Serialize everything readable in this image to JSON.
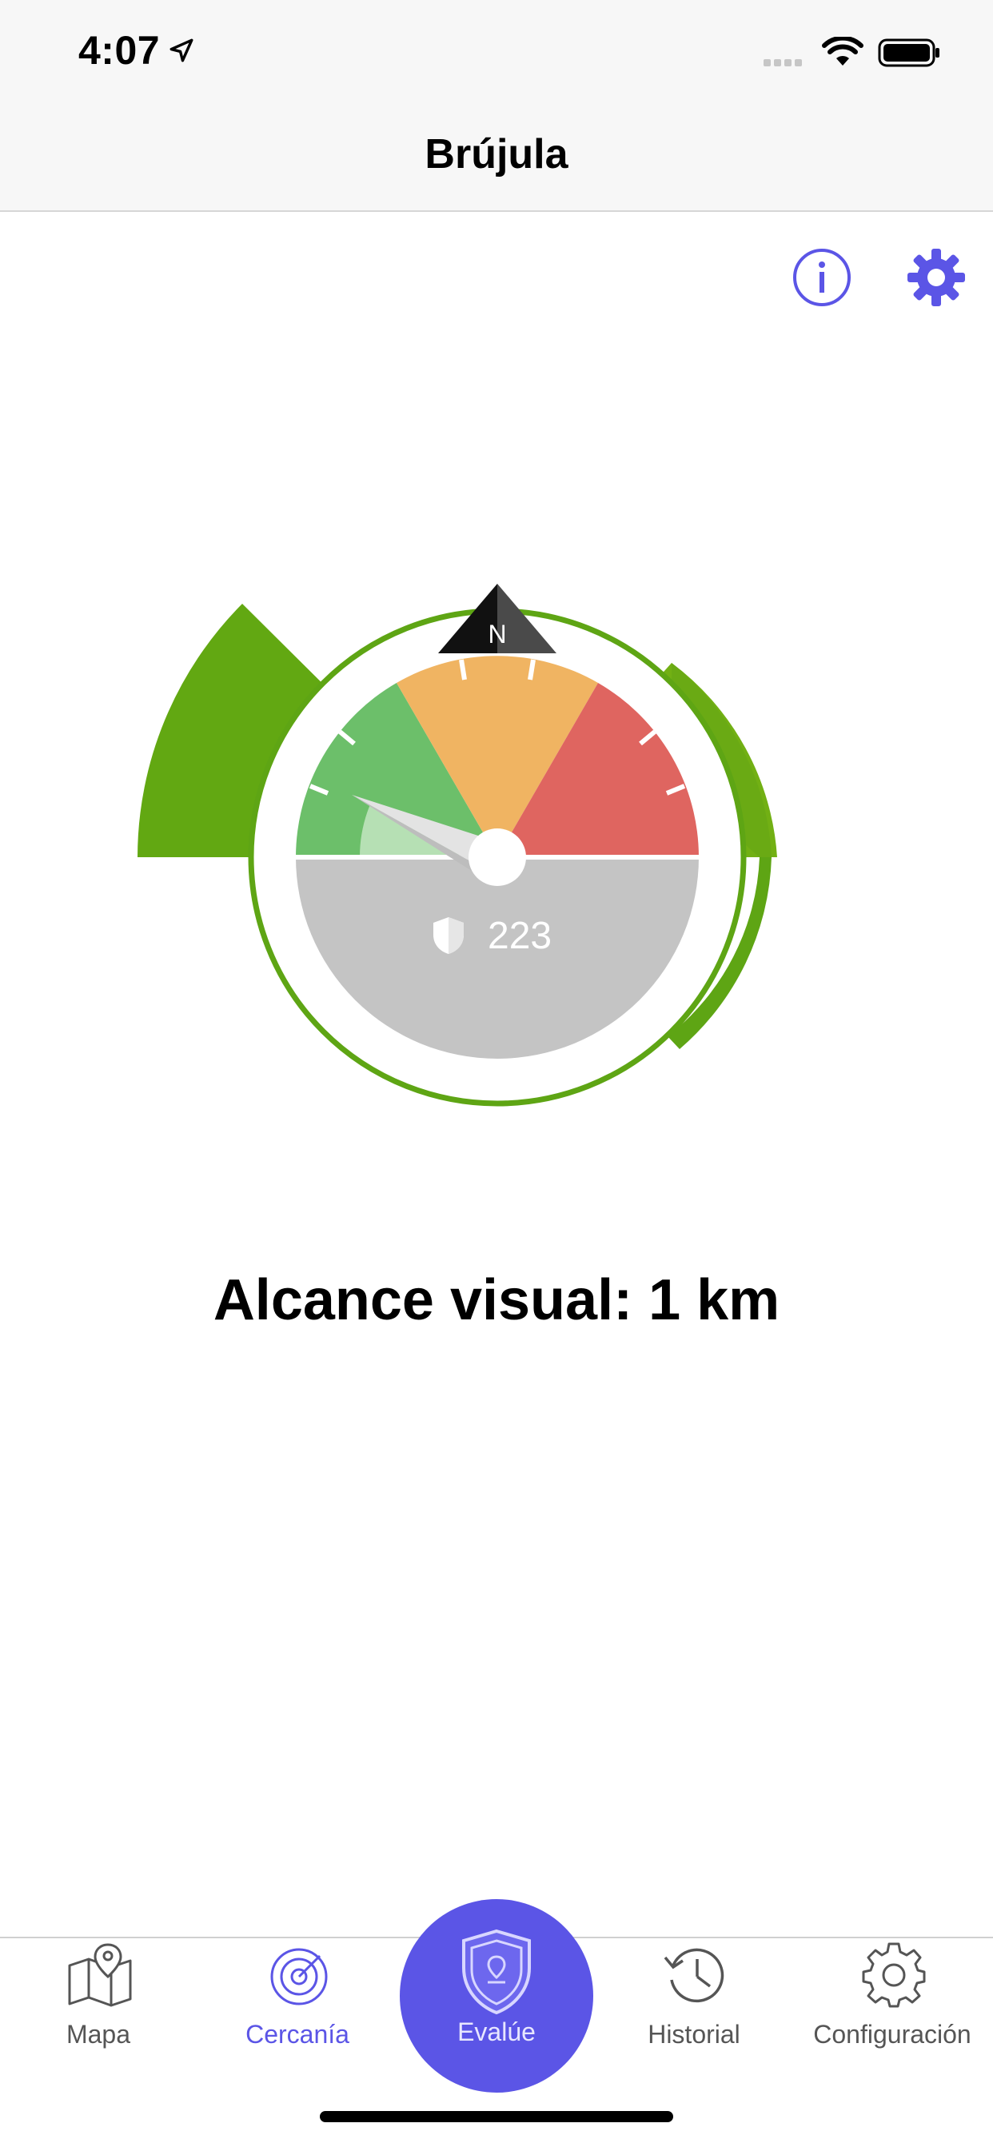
{
  "status": {
    "time": "4:07"
  },
  "nav": {
    "title": "Brújula"
  },
  "gauge": {
    "value": "223",
    "north_label": "N"
  },
  "reach": {
    "text": "Alcance visual: 1 km"
  },
  "tabs": [
    {
      "label": "Mapa",
      "icon": "map-icon"
    },
    {
      "label": "Cercanía",
      "icon": "radar-icon"
    },
    {
      "label": "Evalúe",
      "icon": "shield-location-icon"
    },
    {
      "label": "Historial",
      "icon": "history-icon"
    },
    {
      "label": "Configuración",
      "icon": "gear-icon"
    }
  ],
  "colors": {
    "accent": "#5b55e6",
    "green": "#6cbf6a",
    "orange": "#f0b462",
    "red": "#df6560",
    "gray": "#c4c4c4",
    "ring_green": "#5ea514"
  }
}
